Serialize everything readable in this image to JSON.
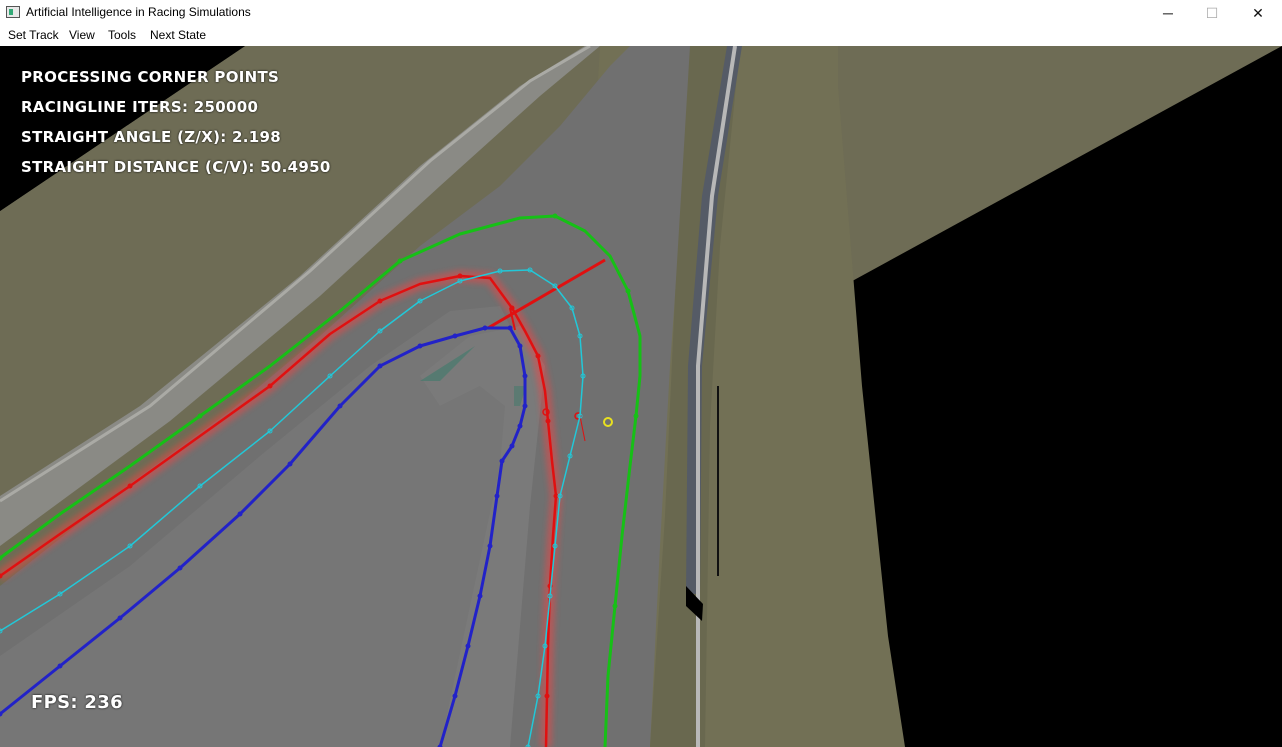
{
  "window": {
    "title": "Artificial Intelligence in Racing Simulations",
    "minimize_glyph": "─",
    "maximize_glyph": "☐",
    "close_glyph": "✕"
  },
  "menu": {
    "items": [
      {
        "label": "Set Track"
      },
      {
        "label": "View"
      },
      {
        "label": "Tools"
      },
      {
        "label": "Next State"
      }
    ]
  },
  "hud": {
    "status": "PROCESSING CORNER POINTS",
    "racingline_iters": "RACINGLINE ITERS: 250000",
    "straight_angle": "STRAIGHT ANGLE (Z/X): 2.198",
    "straight_distance": "STRAIGHT DISTANCE (C/V): 50.4950",
    "fps": "FPS: 236"
  },
  "colors": {
    "background": "#000000",
    "terrain": "#6e6c55",
    "track_surface": "#6f6f6f",
    "barrier": "#9a9a9a",
    "green_line": "#16c016",
    "red_line": "#e01010",
    "cyan_line": "#22c8d8",
    "blue_line": "#2222c8",
    "marker": "#e8e020"
  },
  "icons": {
    "app": "app-window-icon",
    "minimize": "minimize-icon",
    "maximize": "maximize-icon",
    "close": "close-icon"
  }
}
